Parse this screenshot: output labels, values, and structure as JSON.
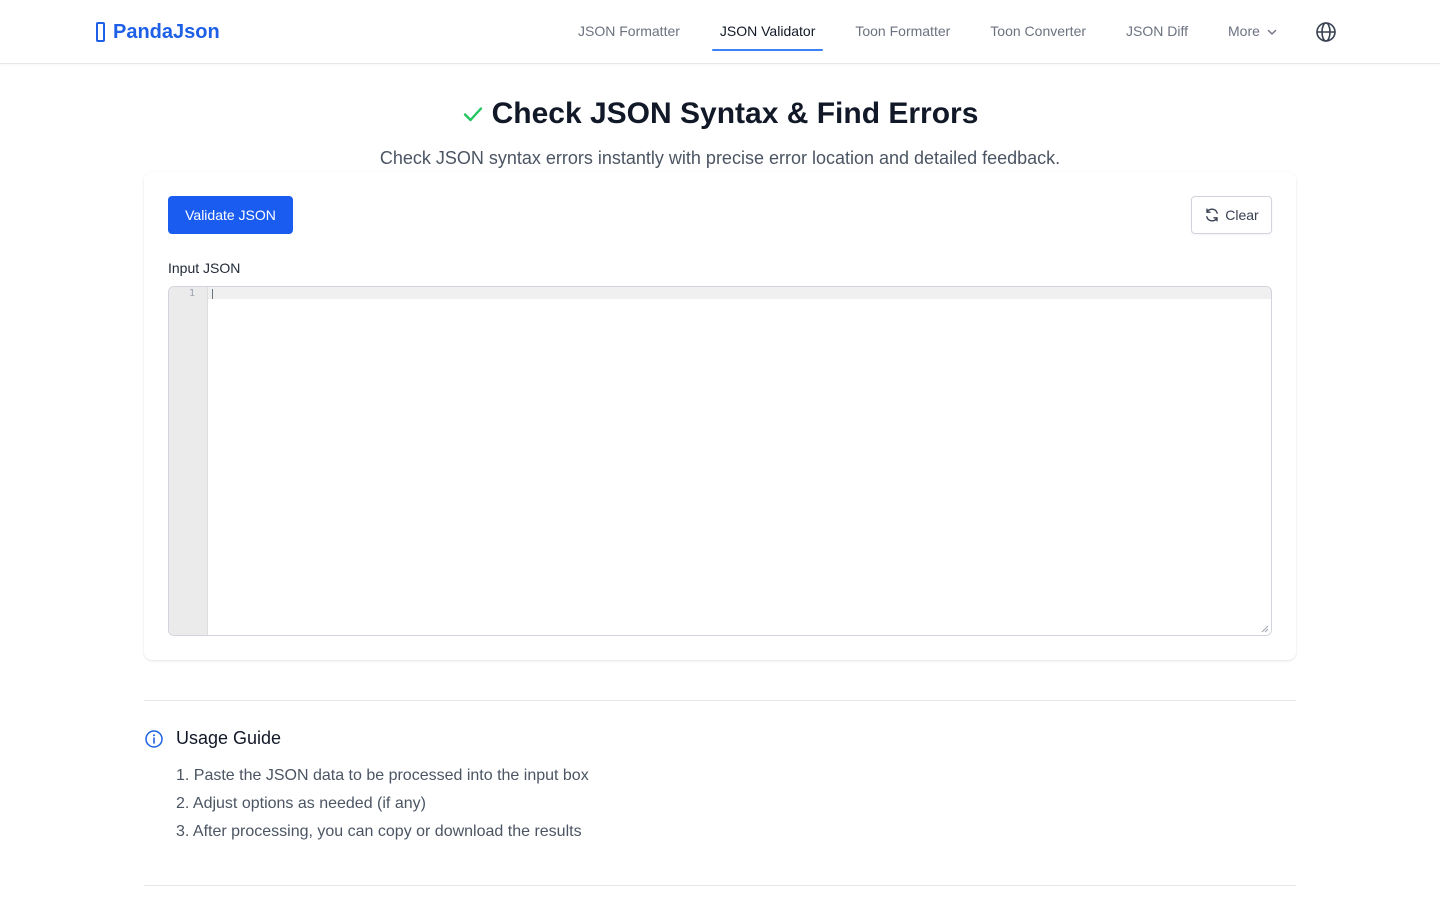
{
  "header": {
    "brand": "PandaJson",
    "nav": [
      {
        "label": "JSON Formatter",
        "active": false
      },
      {
        "label": "JSON Validator",
        "active": true
      },
      {
        "label": "Toon Formatter",
        "active": false
      },
      {
        "label": "Toon Converter",
        "active": false
      },
      {
        "label": "JSON Diff",
        "active": false
      },
      {
        "label": "More",
        "active": false
      }
    ],
    "language_icon": "globe-icon"
  },
  "hero": {
    "icon": "check-icon",
    "title": "Check JSON Syntax & Find Errors",
    "subtitle": "Check JSON syntax errors instantly with precise error location and detailed feedback."
  },
  "tool": {
    "validate_label": "Validate JSON",
    "clear_label": "Clear",
    "input_label": "Input JSON",
    "editor": {
      "line_number": "1",
      "value": ""
    }
  },
  "guide": {
    "icon": "info-icon",
    "title": "Usage Guide",
    "steps": [
      "1. Paste the JSON data to be processed into the input box",
      "2. Adjust options as needed (if any)",
      "3. After processing, you can copy or download the results"
    ]
  },
  "colors": {
    "primary": "#1a5cf0",
    "brand": "#1d5fe6",
    "success": "#22c55e",
    "nav_underline": "#3b82f6"
  }
}
